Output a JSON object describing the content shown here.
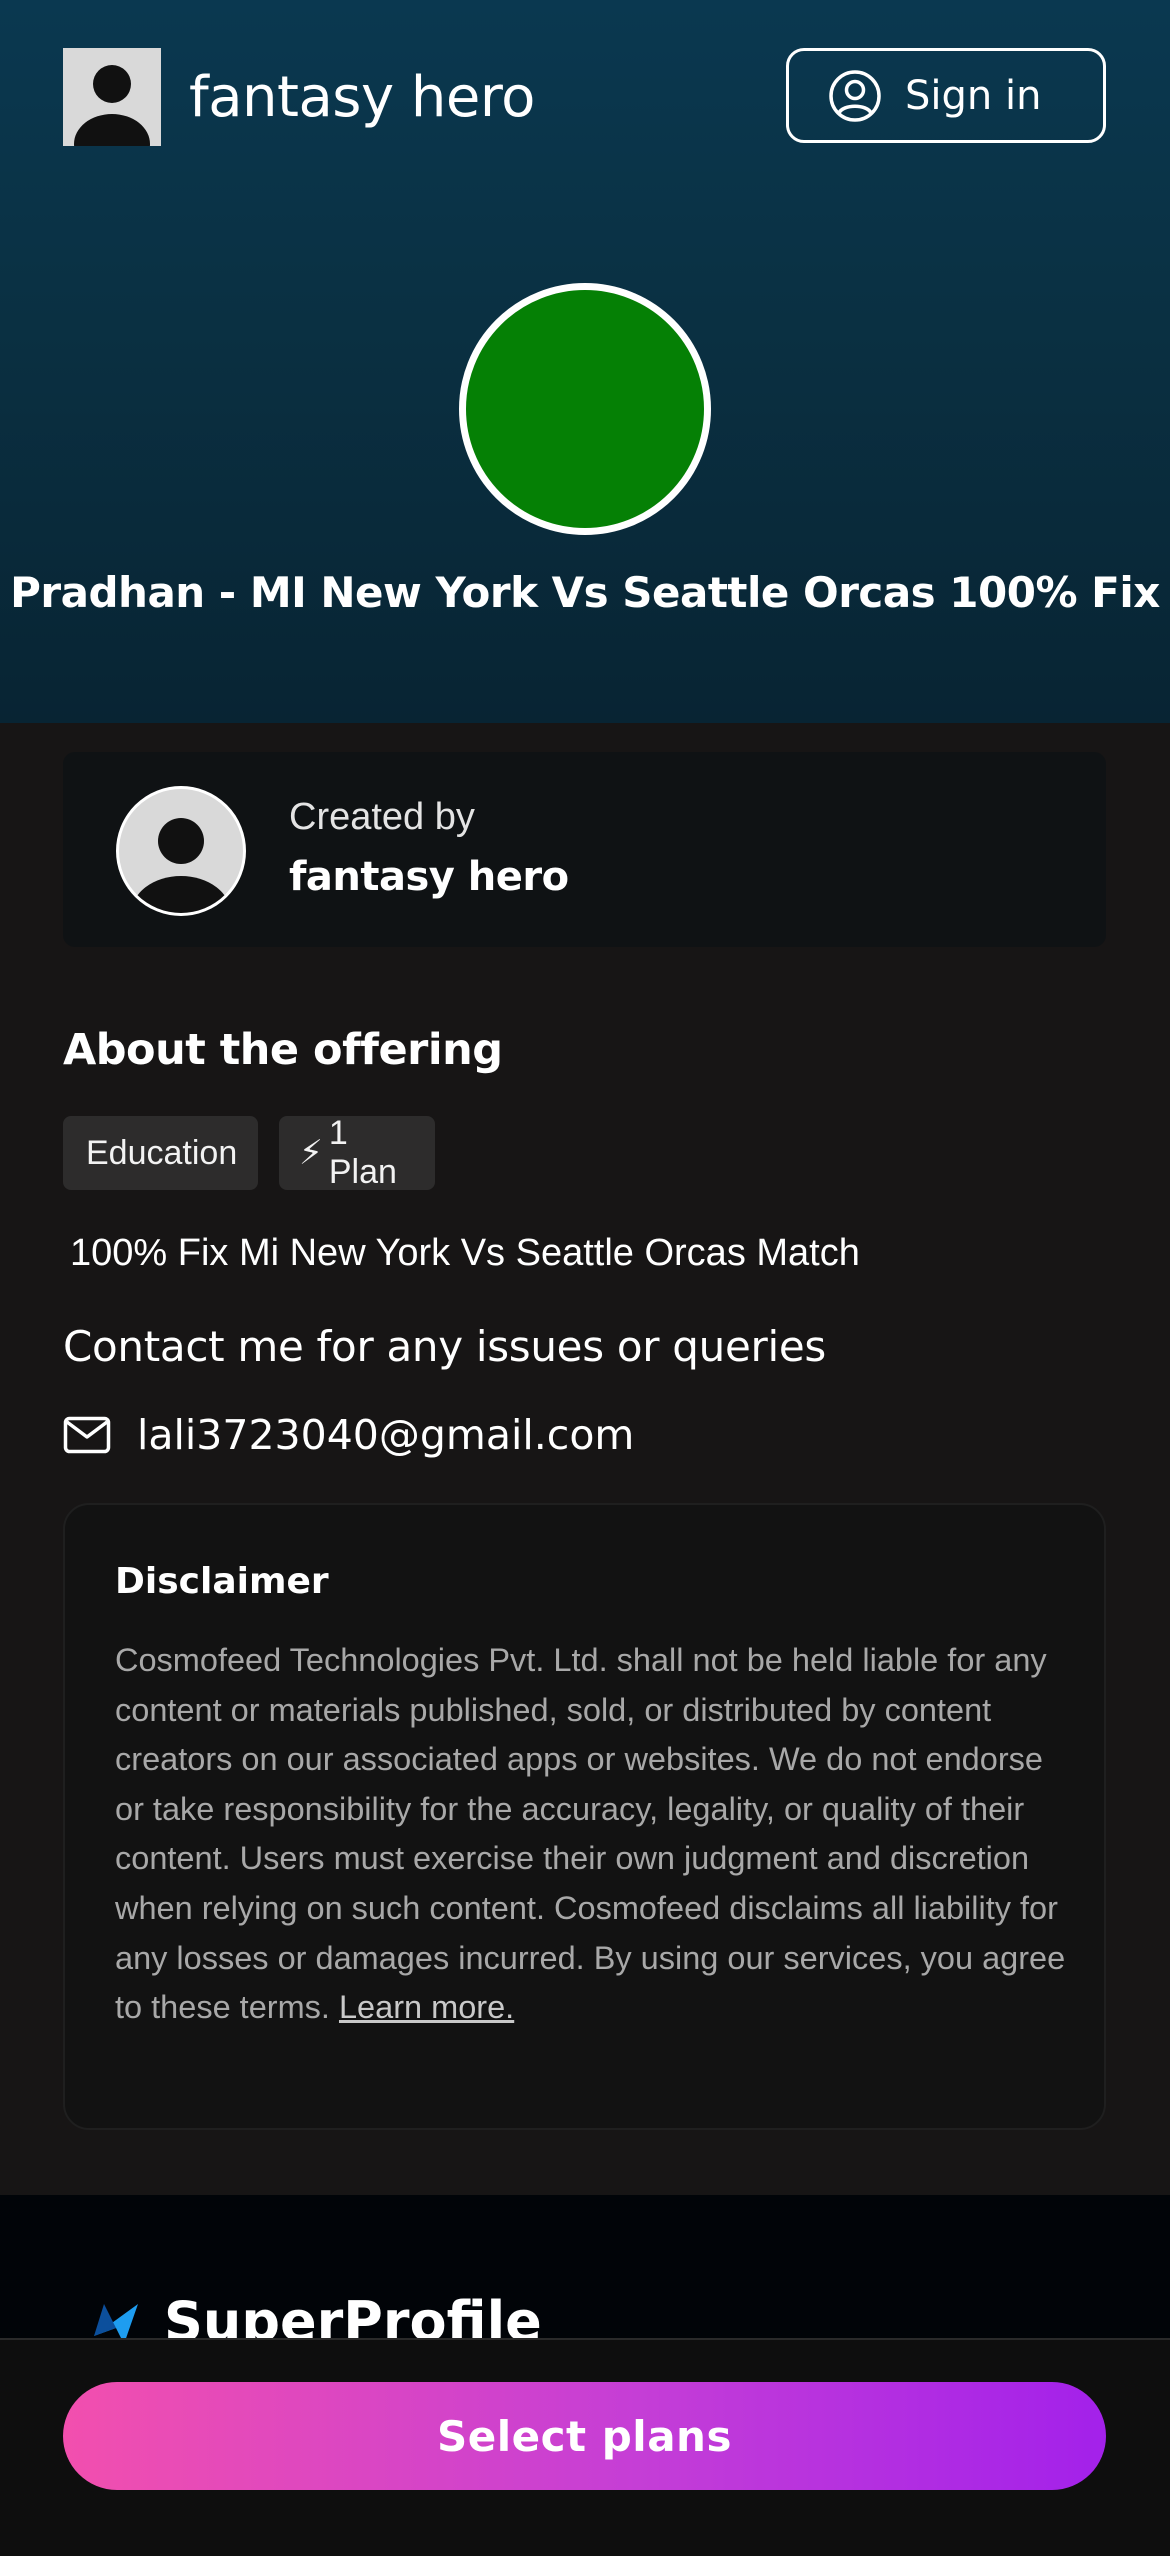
{
  "header": {
    "brand_name": "fantasy hero",
    "sign_in_label": "Sign in"
  },
  "hero": {
    "title": "Pradhan - MI New York Vs Seattle Orcas 100% Fix",
    "image_color": "#058005"
  },
  "creator": {
    "created_by_label": "Created by",
    "name": "fantasy hero"
  },
  "about": {
    "heading": "About the offering",
    "tags": {
      "category": "Education",
      "plans": "1 Plan",
      "plans_icon": "⚡"
    },
    "description": "100% Fix Mi New York Vs Seattle Orcas Match"
  },
  "contact": {
    "heading": "Contact me for any issues or queries",
    "email": "lali3723040@gmail.com"
  },
  "disclaimer": {
    "title": "Disclaimer",
    "body": "Cosmofeed Technologies Pvt. Ltd. shall not be held liable for any content or materials published, sold, or distributed by content creators on our associated apps or websites. We do not endorse or take responsibility for the accuracy, legality, or quality of their content. Users must exercise their own judgment and discretion when relying on such content. Cosmofeed disclaims all liability for any losses or damages incurred. By using our services, you agree to these terms.",
    "learn_more": "Learn more."
  },
  "footer": {
    "logo_text": "SuperProfile"
  },
  "cta": {
    "select_plans_label": "Select plans"
  },
  "colors": {
    "hero_gradient_top": "#0a3850",
    "page_background": "#171515",
    "cta_gradient_start": "#f24fae",
    "cta_gradient_end": "#a321ea"
  }
}
